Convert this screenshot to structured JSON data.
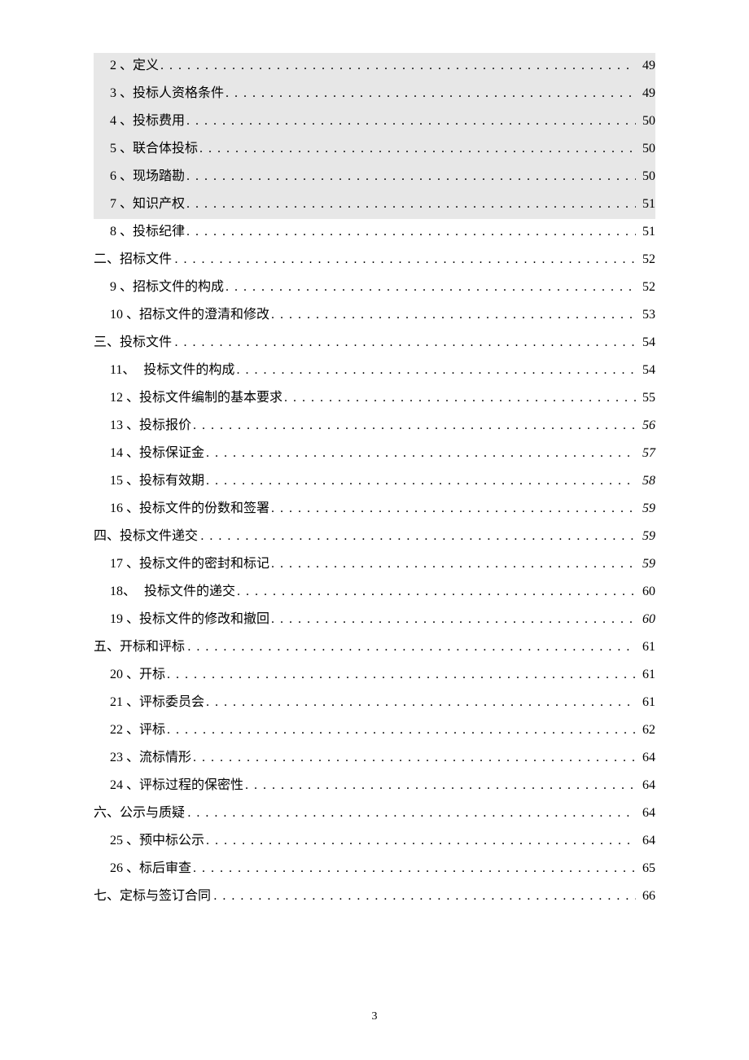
{
  "page_number": "3",
  "toc": [
    {
      "num": "2 、",
      "label": "定义",
      "page": "49",
      "indent": 2,
      "shade": true,
      "italic": false,
      "tight": false
    },
    {
      "num": "3 、",
      "label": "投标人资格条件",
      "page": "49",
      "indent": 2,
      "shade": true,
      "italic": false,
      "tight": false
    },
    {
      "num": "4 、",
      "label": "投标费用",
      "page": "50",
      "indent": 2,
      "shade": true,
      "italic": false,
      "tight": false
    },
    {
      "num": "5 、",
      "label": "联合体投标",
      "page": "50",
      "indent": 2,
      "shade": true,
      "italic": false,
      "tight": false
    },
    {
      "num": "6 、",
      "label": "现场踏勘",
      "page": "50",
      "indent": 2,
      "shade": true,
      "italic": false,
      "tight": false
    },
    {
      "num": "7 、",
      "label": "知识产权",
      "page": "51",
      "indent": 2,
      "shade": true,
      "italic": false,
      "tight": false
    },
    {
      "num": "8 、",
      "label": "投标纪律",
      "page": "51",
      "indent": 2,
      "shade": false,
      "italic": false,
      "tight": false
    },
    {
      "num": "二、",
      "label": "招标文件",
      "page": "52",
      "indent": 1,
      "shade": false,
      "italic": false,
      "tight": false
    },
    {
      "num": "9 、",
      "label": "招标文件的构成",
      "page": "52",
      "indent": 2,
      "shade": false,
      "italic": false,
      "tight": false
    },
    {
      "num": "10 、",
      "label": "招标文件的澄清和修改",
      "page": "53",
      "indent": 2,
      "shade": false,
      "italic": false,
      "tight": false
    },
    {
      "num": "三、",
      "label": "投标文件",
      "page": "54",
      "indent": 1,
      "shade": false,
      "italic": false,
      "tight": false
    },
    {
      "num": "11、",
      "label": "投标文件的构成",
      "page": "54",
      "indent": 2,
      "shade": false,
      "italic": false,
      "tight": true
    },
    {
      "num": "12 、",
      "label": "投标文件编制的基本要求",
      "page": "55",
      "indent": 2,
      "shade": false,
      "italic": false,
      "tight": false
    },
    {
      "num": "13 、",
      "label": "投标报价",
      "page": "56",
      "indent": 2,
      "shade": false,
      "italic": true,
      "tight": false
    },
    {
      "num": "14 、",
      "label": "投标保证金",
      "page": "57",
      "indent": 2,
      "shade": false,
      "italic": true,
      "tight": false
    },
    {
      "num": "15 、",
      "label": "投标有效期",
      "page": "58",
      "indent": 2,
      "shade": false,
      "italic": true,
      "tight": false
    },
    {
      "num": "16 、",
      "label": "投标文件的份数和签署",
      "page": "59",
      "indent": 2,
      "shade": false,
      "italic": true,
      "tight": false
    },
    {
      "num": "四、",
      "label": "投标文件递交",
      "page": "59",
      "indent": 1,
      "shade": false,
      "italic": true,
      "tight": false
    },
    {
      "num": "17 、",
      "label": "投标文件的密封和标记",
      "page": "59",
      "indent": 2,
      "shade": false,
      "italic": true,
      "tight": false
    },
    {
      "num": "18、",
      "label": "投标文件的递交",
      "page": "60",
      "indent": 2,
      "shade": false,
      "italic": false,
      "tight": true
    },
    {
      "num": "19 、",
      "label": "投标文件的修改和撤回",
      "page": "60",
      "indent": 2,
      "shade": false,
      "italic": true,
      "tight": false
    },
    {
      "num": "五、",
      "label": "开标和评标",
      "page": "61",
      "indent": 1,
      "shade": false,
      "italic": false,
      "tight": false
    },
    {
      "num": "20 、",
      "label": "开标",
      "page": "61",
      "indent": 2,
      "shade": false,
      "italic": false,
      "tight": false
    },
    {
      "num": "21 、",
      "label": "评标委员会",
      "page": "61",
      "indent": 2,
      "shade": false,
      "italic": false,
      "tight": false
    },
    {
      "num": "22 、",
      "label": "评标",
      "page": "62",
      "indent": 2,
      "shade": false,
      "italic": false,
      "tight": false
    },
    {
      "num": "23 、",
      "label": "流标情形",
      "page": "64",
      "indent": 2,
      "shade": false,
      "italic": false,
      "tight": false
    },
    {
      "num": "24 、",
      "label": "评标过程的保密性",
      "page": "64",
      "indent": 2,
      "shade": false,
      "italic": false,
      "tight": false
    },
    {
      "num": "六、",
      "label": "公示与质疑",
      "page": "64",
      "indent": 1,
      "shade": false,
      "italic": false,
      "tight": false
    },
    {
      "num": "25 、",
      "label": "预中标公示",
      "page": "64",
      "indent": 2,
      "shade": false,
      "italic": false,
      "tight": false
    },
    {
      "num": "26 、",
      "label": "标后审查",
      "page": "65",
      "indent": 2,
      "shade": false,
      "italic": false,
      "tight": false
    },
    {
      "num": "七、",
      "label": "定标与签订合同",
      "page": "66",
      "indent": 1,
      "shade": false,
      "italic": false,
      "tight": false
    }
  ]
}
